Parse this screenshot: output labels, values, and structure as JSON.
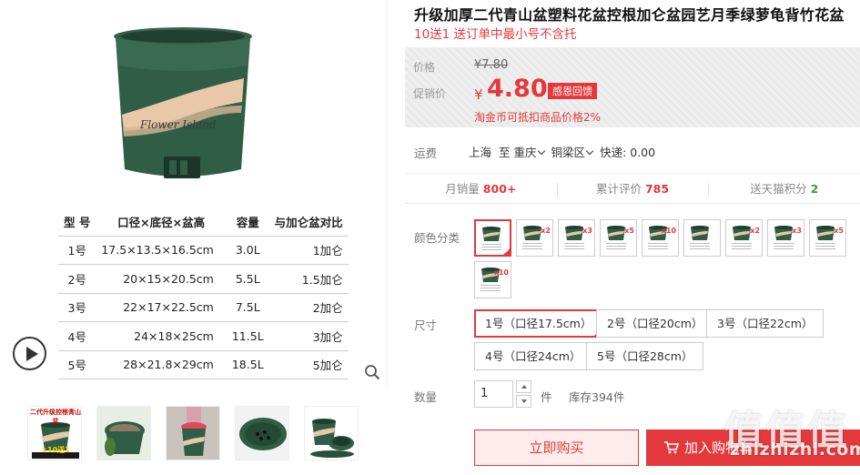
{
  "gallery": {
    "pot_brand_text": "Flower Island",
    "spec_table": {
      "headers": [
        "型 号",
        "口径×底径×盆高",
        "容量",
        "与加仑盆对比"
      ],
      "rows": [
        [
          "1号",
          "17.5×13.5×16.5cm",
          "3.0L",
          "1加仑"
        ],
        [
          "2号",
          "20×15×20.5cm",
          "5.5L",
          "1.5加仑"
        ],
        [
          "3号",
          "22×17×22.5cm",
          "7.5L",
          "2加仑"
        ],
        [
          "4号",
          "24×18×25cm",
          "11.5L",
          "3加仑"
        ],
        [
          "5号",
          "28×21.8×29cm",
          "18.5L",
          "5加仑"
        ]
      ]
    },
    "thumb_caption_1": "二代升级控根青山盆",
    "thumb_caption_2": "×10送1"
  },
  "product": {
    "title": "升级加厚二代青山盆塑料花盆控根加仑盆园艺月季绿萝龟背竹花盆",
    "subtitle": "10送1 送订单中最小号不含托"
  },
  "price": {
    "orig_label": "价格",
    "orig_value": "¥7.80",
    "promo_label": "促销价",
    "currency": "¥",
    "promo_value": "4.80",
    "promo_tag": "感恩回馈",
    "coin_note": "淘金币可抵扣商品价格2%"
  },
  "shipping": {
    "label": "运费",
    "from": "上海",
    "to_word": "至",
    "city": "重庆",
    "district": "铜梁区",
    "fee": "快递: 0.00"
  },
  "stats": {
    "monthly_sales_label": "月销量",
    "monthly_sales_value": "800+",
    "reviews_label": "累计评价",
    "reviews_value": "785",
    "points_label": "送天猫积分",
    "points_value": "2"
  },
  "colors": {
    "label": "颜色分类",
    "options": [
      "",
      "x2",
      "x3",
      "x5",
      "x10",
      "",
      "x2",
      "x3",
      "x5",
      "x10"
    ]
  },
  "sizes": {
    "label": "尺寸",
    "options": [
      "1号（口径17.5cm）",
      "2号（口径20cm）",
      "3号（口径22cm）",
      "4号（口径24cm）",
      "5号（口径28cm）"
    ]
  },
  "quantity": {
    "label": "数量",
    "value": "1",
    "unit": "件",
    "stock": "库存394件"
  },
  "actions": {
    "buy_now": "立即购买",
    "add_cart": "加入购物车"
  },
  "watermark": {
    "glyphs": "值值值",
    "site": "zhizhizhi.com"
  },
  "colors_hex": {
    "accent": "#e4393c",
    "pot_green": "#2f5d45",
    "pot_band": "#e8c8a8"
  }
}
